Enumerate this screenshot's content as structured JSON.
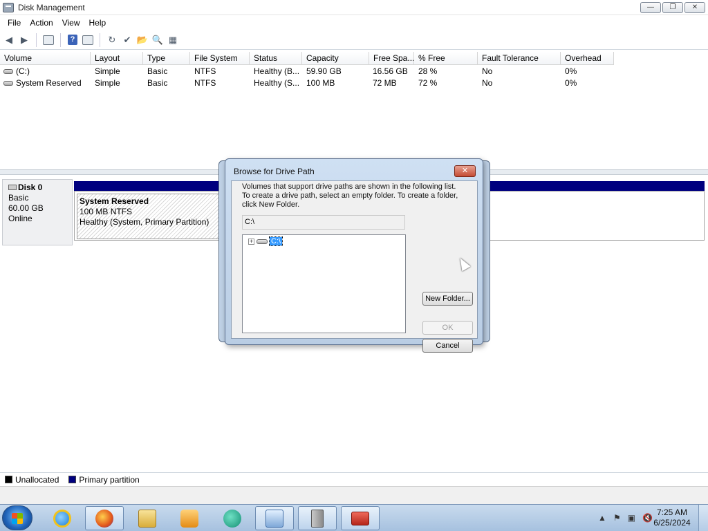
{
  "window": {
    "title": "Disk Management",
    "min": "—",
    "max": "❐",
    "close": "✕"
  },
  "menu": {
    "items": [
      "File",
      "Action",
      "View",
      "Help"
    ]
  },
  "volumes": {
    "columns": [
      "Volume",
      "Layout",
      "Type",
      "File System",
      "Status",
      "Capacity",
      "Free Spa...",
      "% Free",
      "Fault Tolerance",
      "Overhead"
    ],
    "rows": [
      [
        "(C:)",
        "Simple",
        "Basic",
        "NTFS",
        "Healthy (B...",
        "59.90 GB",
        "16.56 GB",
        "28 %",
        "No",
        "0%"
      ],
      [
        "System Reserved",
        "Simple",
        "Basic",
        "NTFS",
        "Healthy (S...",
        "100 MB",
        "72 MB",
        "72 %",
        "No",
        "0%"
      ]
    ]
  },
  "disk": {
    "name": "Disk 0",
    "type": "Basic",
    "size": "60.00 GB",
    "status": "Online",
    "partition": {
      "name": "System Reserved",
      "info": "100 MB NTFS",
      "status": "Healthy (System, Primary Partition)"
    }
  },
  "legend": {
    "unallocated": "Unallocated",
    "primary": "Primary partition",
    "unallocated_color": "#000000",
    "primary_color": "#00007f"
  },
  "dialog": {
    "title": "Browse for Drive Path",
    "line1": "Volumes that support drive paths are shown in the following list.",
    "line2": "To create a drive path, select an empty folder. To create a folder,",
    "line3": "click New Folder.",
    "path": "C:\\",
    "tree_item": "C:\\",
    "expander": "+",
    "new_folder": "New Folder...",
    "ok": "OK",
    "cancel": "Cancel",
    "close": "✕"
  },
  "taskbar": {
    "time": "7:25 AM",
    "date": "6/25/2024",
    "apps": [
      "internet-explorer",
      "firefox",
      "file-explorer",
      "media-player",
      "browser",
      "server-manager",
      "network",
      "toolbox"
    ]
  },
  "colors": {
    "accent": "#3399ff",
    "disk_bar": "#00007f",
    "taskbar": "#b8cfe8"
  }
}
